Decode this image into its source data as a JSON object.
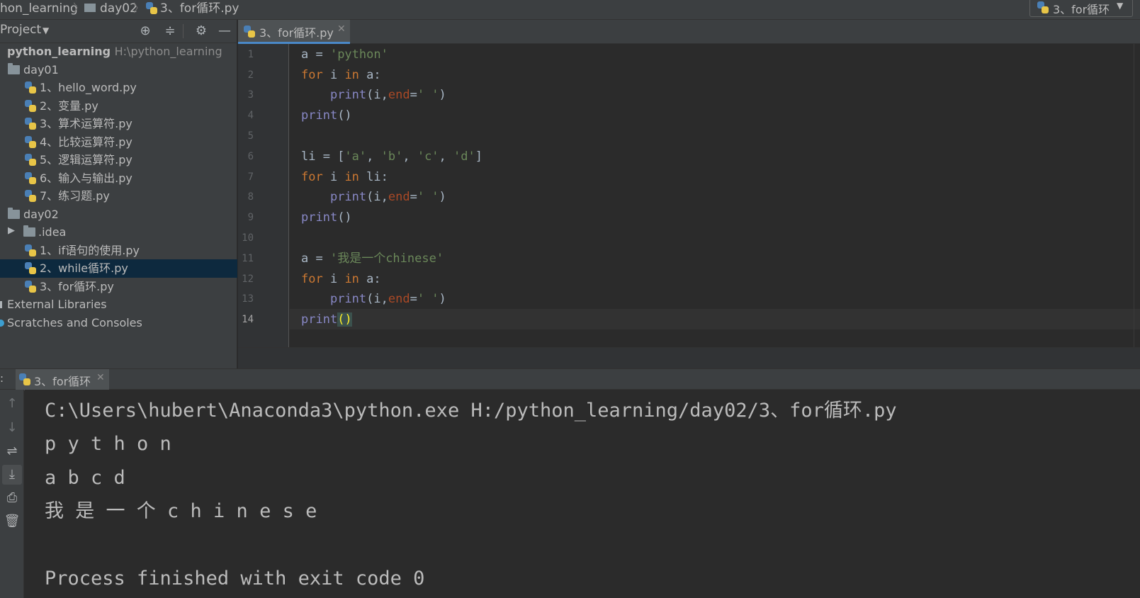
{
  "breadcrumb": {
    "project": "hon_learning",
    "folder": "day02",
    "file": "3、for循环.py",
    "run_config": "3、for循环"
  },
  "project_panel": {
    "title": "Project",
    "tree": [
      {
        "label": "python_learning",
        "hint": "H:\\python_learning",
        "type": "root"
      },
      {
        "label": "day01",
        "type": "folder"
      },
      {
        "label": "1、hello_word.py",
        "type": "py"
      },
      {
        "label": "2、变量.py",
        "type": "py"
      },
      {
        "label": "3、算术运算符.py",
        "type": "py"
      },
      {
        "label": "4、比较运算符.py",
        "type": "py"
      },
      {
        "label": "5、逻辑运算符.py",
        "type": "py"
      },
      {
        "label": "6、输入与输出.py",
        "type": "py"
      },
      {
        "label": "7、练习题.py",
        "type": "py"
      },
      {
        "label": "day02",
        "type": "folder"
      },
      {
        "label": ".idea",
        "type": "folder"
      },
      {
        "label": "1、if语句的使用.py",
        "type": "py"
      },
      {
        "label": "2、while循环.py",
        "type": "py",
        "selected": true
      },
      {
        "label": "3、for循环.py",
        "type": "py"
      },
      {
        "label": "External Libraries",
        "type": "lib"
      },
      {
        "label": "Scratches and Consoles",
        "type": "scratch"
      }
    ]
  },
  "editor": {
    "tab_label": "3、for循环.py",
    "line_numbers": [
      "1",
      "2",
      "3",
      "4",
      "5",
      "6",
      "7",
      "8",
      "9",
      "10",
      "11",
      "12",
      "13",
      "14"
    ],
    "current_line": "14",
    "lines": [
      "a = 'python'",
      "for i in a:",
      "    print(i,end=' ')",
      "print()",
      "",
      "li = ['a', 'b', 'c', 'd']",
      "for i in li:",
      "    print(i,end=' ')",
      "print()",
      "",
      "a = '我是一个chinese'",
      "for i in a:",
      "    print(i,end=' ')",
      "print()"
    ]
  },
  "run_panel": {
    "tab_label": "3、for循环",
    "output": [
      "C:\\Users\\hubert\\Anaconda3\\python.exe H:/python_learning/day02/3、for循环.py",
      "p y t h o n",
      "a b c d",
      "我 是 一 个 c h i n e s e",
      "",
      "Process finished with exit code 0"
    ]
  },
  "colors": {
    "keyword": "#cc7832",
    "string": "#6a8759",
    "builtin": "#8888c6",
    "param": "#aa4926",
    "selection": "#0d293e"
  }
}
